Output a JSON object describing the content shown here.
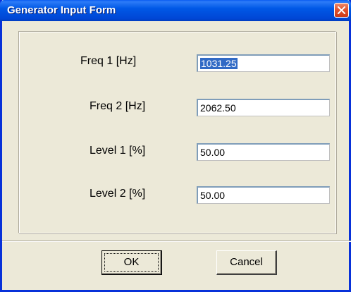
{
  "window": {
    "title": "Generator Input Form",
    "close_icon": "close-x-icon"
  },
  "form": {
    "fields": [
      {
        "label": "Freq 1 [Hz]",
        "value": "1031.25",
        "selected": true
      },
      {
        "label": "Freq 2 [Hz]",
        "value": "2062.50"
      },
      {
        "label": "Level 1 [%]",
        "value": "50.00"
      },
      {
        "label": "Level 2 [%]",
        "value": "50.00"
      }
    ]
  },
  "buttons": {
    "ok_label": "OK",
    "cancel_label": "Cancel"
  },
  "colors": {
    "titlebar": "#0058e6",
    "face": "#ece9d8",
    "selection": "#316ac5",
    "close": "#e2532f"
  }
}
